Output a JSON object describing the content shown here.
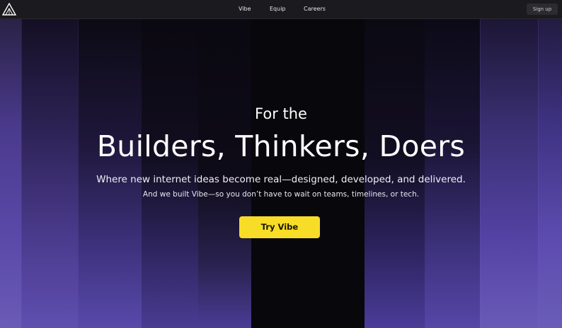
{
  "nav": {
    "logo_icon": "triangle-logo-icon",
    "links": [
      {
        "label": "Vibe"
      },
      {
        "label": "Equip"
      },
      {
        "label": "Careers"
      }
    ],
    "signup_label": "Sign up"
  },
  "hero": {
    "eyebrow": "For the",
    "headline": "Builders, Thinkers, Doers",
    "subtitle": "Where new internet ideas become real—designed, developed, and delivered.",
    "tagline": "And we built Vibe—so you don’t have to wait on teams, timelines, or tech.",
    "cta_label": "Try Vibe"
  },
  "colors": {
    "nav_background": "#1b1a1e",
    "cta_background": "#f7dd27",
    "accent_purple": "#5a49a8"
  }
}
